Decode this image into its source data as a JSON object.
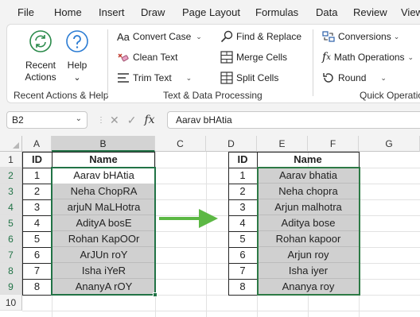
{
  "menu": [
    "File",
    "Home",
    "Insert",
    "Draw",
    "Page Layout",
    "Formulas",
    "Data",
    "Review",
    "View"
  ],
  "ribbon": {
    "recent": {
      "label_line1": "Recent",
      "label_line2": "Actions",
      "group": "Recent Actions & Help"
    },
    "help": {
      "label": "Help",
      "caret": "⌄"
    },
    "text_group": {
      "convert_case": "Convert Case",
      "clean_text": "Clean Text",
      "trim_text": "Trim Text",
      "find_replace": "Find & Replace",
      "merge_cells": "Merge Cells",
      "split_cells": "Split Cells",
      "group": "Text & Data Processing"
    },
    "quick_group": {
      "conversions": "Conversions",
      "math_operations": "Math Operations",
      "round": "Round",
      "group": "Quick Operatio"
    }
  },
  "formula_bar": {
    "name_box": "B2",
    "fx": "fx",
    "value": "Aarav bHAtia"
  },
  "columns": [
    "A",
    "B",
    "C",
    "D",
    "E",
    "F",
    "G"
  ],
  "rows": [
    "1",
    "2",
    "3",
    "4",
    "5",
    "6",
    "7",
    "8",
    "9",
    "10"
  ],
  "left_table": {
    "headers": [
      "ID",
      "Name"
    ],
    "ids": [
      "1",
      "2",
      "3",
      "4",
      "5",
      "6",
      "7",
      "8"
    ],
    "names": [
      "Aarav bHAtia",
      "Neha ChopRA",
      "arjuN MaLHotra",
      "AdityA bosE",
      "Rohan KapOOr",
      "ArJUn roY",
      "Isha iYeR",
      "AnanyA rOY"
    ]
  },
  "right_table": {
    "headers": [
      "ID",
      "Name"
    ],
    "ids": [
      "1",
      "2",
      "3",
      "4",
      "5",
      "6",
      "7",
      "8"
    ],
    "names": [
      "Aarav bhatia",
      "Neha chopra",
      "Arjun malhotra",
      "Aditya bose",
      "Rohan kapoor",
      "Arjun roy",
      "Isha iyer",
      "Ananya roy"
    ]
  },
  "colors": {
    "accent_green": "#217346",
    "arrow_green": "#5cb844",
    "cell_gray": "#d0d0d0",
    "help_blue": "#2b7cd3"
  }
}
